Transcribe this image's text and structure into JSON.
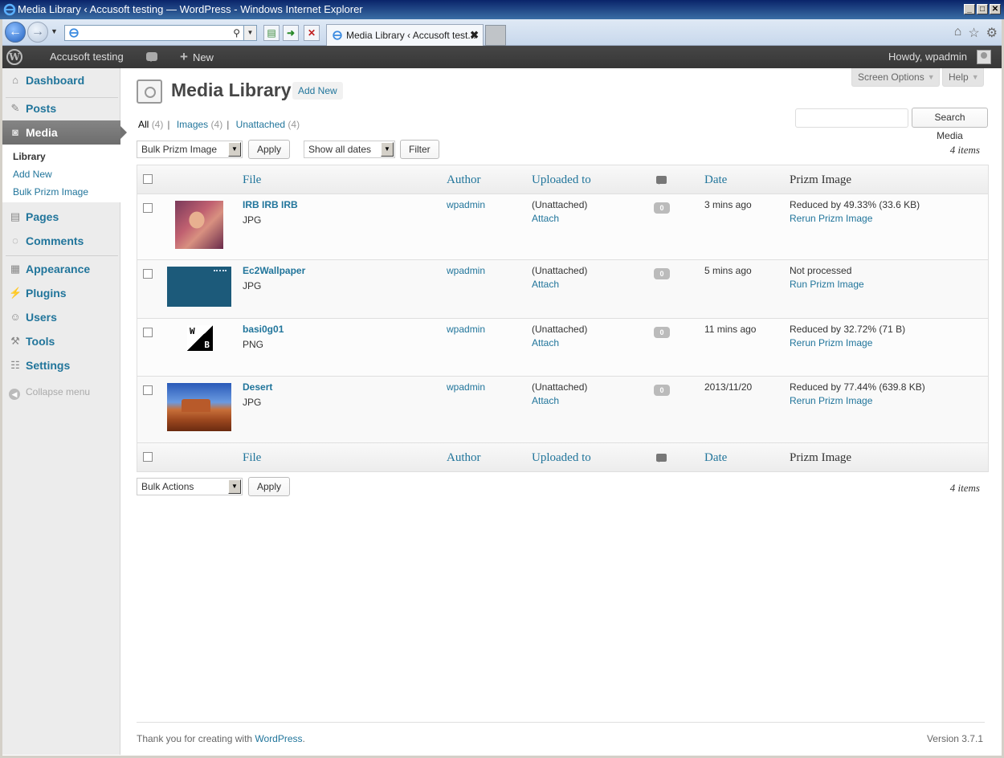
{
  "window": {
    "title": "Media Library ‹ Accusoft testing — WordPress - Windows Internet Explorer",
    "controls": [
      "_",
      "□",
      "✕"
    ]
  },
  "browser": {
    "address_value": "",
    "tab_title": "Media Library ‹ Accusoft test...",
    "tab_close": "✖"
  },
  "adminbar": {
    "logo": "W",
    "site_name": "Accusoft testing",
    "new_label": "New",
    "howdy": "Howdy, wpadmin"
  },
  "menu": {
    "dashboard": "Dashboard",
    "posts": "Posts",
    "media": "Media",
    "media_sub": {
      "library": "Library",
      "add_new": "Add New",
      "bulk": "Bulk Prizm Image"
    },
    "pages": "Pages",
    "comments": "Comments",
    "appearance": "Appearance",
    "plugins": "Plugins",
    "users": "Users",
    "tools": "Tools",
    "settings": "Settings",
    "collapse": "Collapse menu"
  },
  "page": {
    "title": "Media Library",
    "add_new": "Add New",
    "screen_options": "Screen Options",
    "help": "Help",
    "search_value": "",
    "search_button": "Search Media",
    "filters": {
      "all": "All",
      "all_count": "(4)",
      "images": "Images",
      "images_count": "(4)",
      "unattached": "Unattached",
      "unattached_count": "(4)"
    },
    "bulk_top": "Bulk Prizm Image",
    "apply": "Apply",
    "dates": "Show all dates",
    "filter": "Filter",
    "items_count": "4 items",
    "bulk_bottom": "Bulk Actions"
  },
  "table": {
    "headers": {
      "file": "File",
      "author": "Author",
      "uploaded": "Uploaded to",
      "date": "Date",
      "prizm": "Prizm Image"
    },
    "rows": [
      {
        "name": "IRB IRB IRB",
        "type": "JPG",
        "author": "wpadmin",
        "uploaded": "(Unattached)",
        "attach": "Attach",
        "comments": "0",
        "date": "3 mins ago",
        "prizm": "Reduced by 49.33% (33.6 KB)",
        "action": "Rerun Prizm Image"
      },
      {
        "name": "Ec2Wallpaper",
        "type": "JPG",
        "author": "wpadmin",
        "uploaded": "(Unattached)",
        "attach": "Attach",
        "comments": "0",
        "date": "5 mins ago",
        "prizm": "Not processed",
        "action": "Run Prizm Image"
      },
      {
        "name": "basi0g01",
        "type": "PNG",
        "author": "wpadmin",
        "uploaded": "(Unattached)",
        "attach": "Attach",
        "comments": "0",
        "date": "11 mins ago",
        "prizm": "Reduced by 32.72% (71 B)",
        "action": "Rerun Prizm Image"
      },
      {
        "name": "Desert",
        "type": "JPG",
        "author": "wpadmin",
        "uploaded": "(Unattached)",
        "attach": "Attach",
        "comments": "0",
        "date": "2013/11/20",
        "prizm": "Reduced by 77.44% (639.8 KB)",
        "action": "Rerun Prizm Image"
      }
    ],
    "thumb_labels": {
      "w": "W",
      "b": "B"
    }
  },
  "footer": {
    "thanks": "Thank you for creating with ",
    "wp_link": "WordPress",
    "dot": ".",
    "version": "Version 3.7.1"
  }
}
